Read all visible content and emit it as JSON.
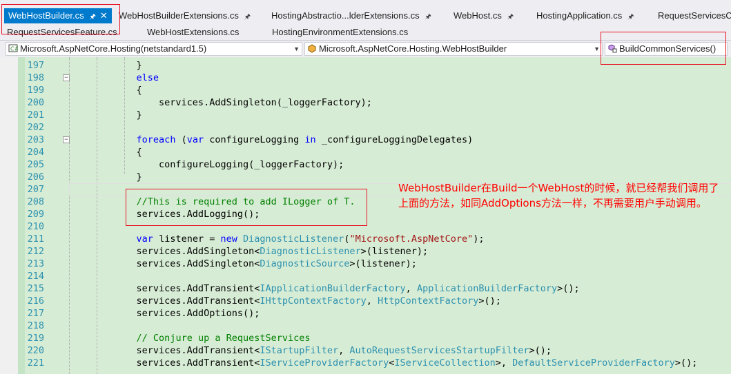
{
  "tabs_row1": [
    {
      "label": "WebHostBuilder.cs",
      "active": true
    },
    {
      "label": "WebHostBuilderExtensions.cs"
    },
    {
      "label": "HostingAbstractio...lderExtensions.cs"
    },
    {
      "label": "WebHost.cs"
    },
    {
      "label": "HostingApplication.cs"
    },
    {
      "label": "RequestServicesC..."
    }
  ],
  "tabs_row2": [
    {
      "label": "RequestServicesFeature.cs"
    },
    {
      "label": "WebHostExtensions.cs"
    },
    {
      "label": "HostingEnvironmentExtensions.cs"
    }
  ],
  "navbar": {
    "project": "Microsoft.AspNetCore.Hosting(netstandard1.5)",
    "type": "Microsoft.AspNetCore.Hosting.WebHostBuilder",
    "member": "BuildCommonServices()"
  },
  "code_lines": [
    {
      "n": "197",
      "t": "                }"
    },
    {
      "n": "198",
      "t": "                else"
    },
    {
      "n": "199",
      "t": "                {"
    },
    {
      "n": "200",
      "t": "                    services.AddSingleton(_loggerFactory);"
    },
    {
      "n": "201",
      "t": "                }"
    },
    {
      "n": "202",
      "t": ""
    },
    {
      "n": "203",
      "t": "                foreach (var configureLogging in _configureLoggingDelegates)"
    },
    {
      "n": "204",
      "t": "                {"
    },
    {
      "n": "205",
      "t": "                    configureLogging(_loggerFactory);"
    },
    {
      "n": "206",
      "t": "                }"
    },
    {
      "n": "207",
      "t": ""
    },
    {
      "n": "208",
      "t": "                //This is required to add ILogger of T."
    },
    {
      "n": "209",
      "t": "                services.AddLogging();"
    },
    {
      "n": "210",
      "t": ""
    },
    {
      "n": "211",
      "t": "                var listener = new DiagnosticListener(\"Microsoft.AspNetCore\");"
    },
    {
      "n": "212",
      "t": "                services.AddSingleton<DiagnosticListener>(listener);"
    },
    {
      "n": "213",
      "t": "                services.AddSingleton<DiagnosticSource>(listener);"
    },
    {
      "n": "214",
      "t": ""
    },
    {
      "n": "215",
      "t": "                services.AddTransient<IApplicationBuilderFactory, ApplicationBuilderFactory>();"
    },
    {
      "n": "216",
      "t": "                services.AddTransient<IHttpContextFactory, HttpContextFactory>();"
    },
    {
      "n": "217",
      "t": "                services.AddOptions();"
    },
    {
      "n": "218",
      "t": ""
    },
    {
      "n": "219",
      "t": "                // Conjure up a RequestServices"
    },
    {
      "n": "220",
      "t": "                services.AddTransient<IStartupFilter, AutoRequestServicesStartupFilter>();"
    },
    {
      "n": "221",
      "t": "                services.AddTransient<IServiceProviderFactory<IServiceCollection>, DefaultServiceProviderFactory>();"
    }
  ],
  "annotation": "WebHostBuilder在Build一个WebHost的时候，就已经帮我们调用了上面的方法，如同AddOptions方法一样，不再需要用户手动调用。",
  "colors": {
    "accent": "#007acc",
    "keyword": "#0000ff",
    "type": "#2b91af",
    "comment": "#008000",
    "string": "#a31515",
    "annotation": "#ff0000",
    "highlight_box": "#e81123"
  }
}
